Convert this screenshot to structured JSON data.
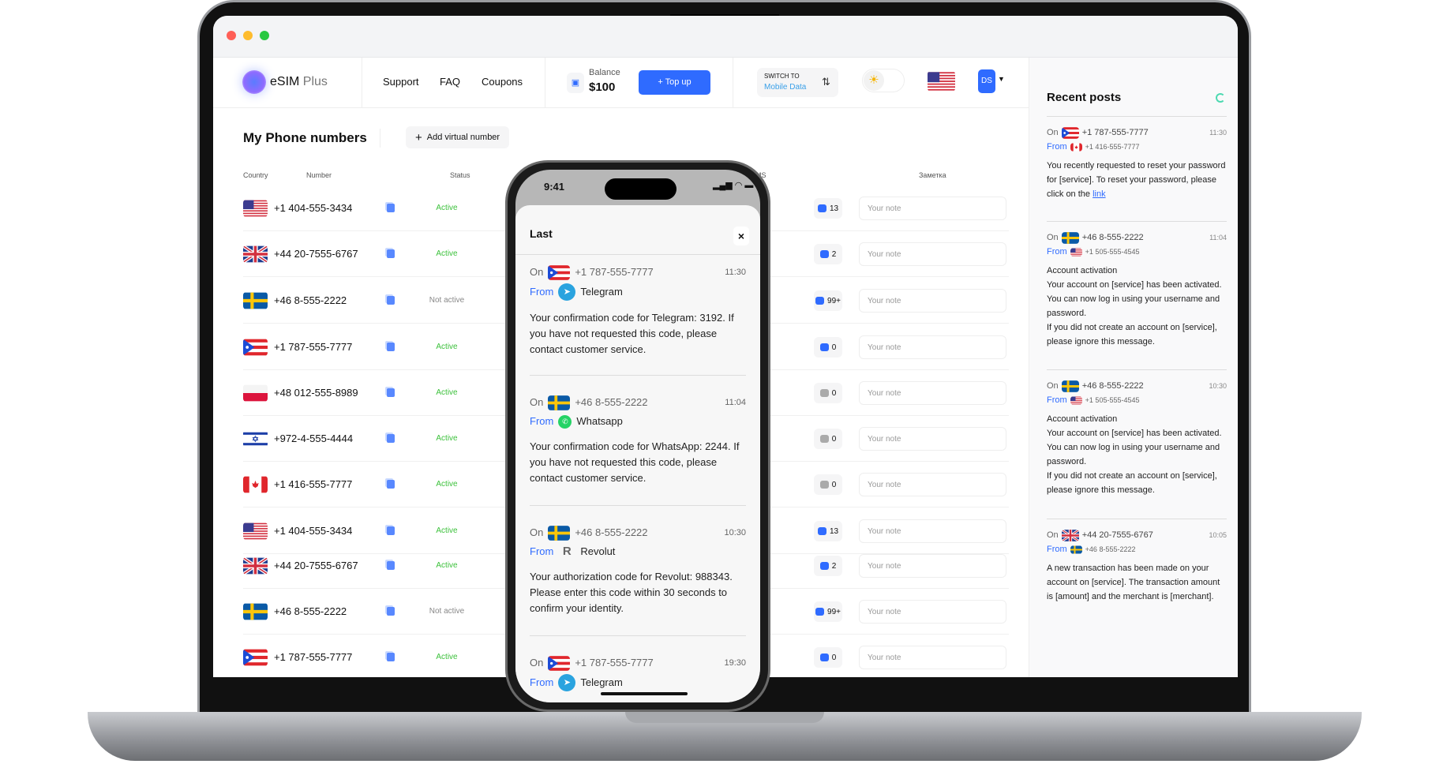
{
  "header": {
    "logo": "eSIM",
    "logo_plus": " Plus",
    "nav": [
      "Support",
      "FAQ",
      "Coupons"
    ],
    "balance_label": "Balance",
    "balance_value": "$100",
    "topup": "+ Top up",
    "switch_label": "SWITCH TO",
    "switch_value": "Mobile Data",
    "avatar": "DS",
    "theme_icon": "sun-icon",
    "flag": "us"
  },
  "main": {
    "title": "My Phone numbers",
    "add_button": "Add virtual number",
    "columns": {
      "country": "Country",
      "number": "Number",
      "status": "Status",
      "sms": "SMS",
      "note": "Заметка"
    },
    "rows": [
      {
        "flag": "us",
        "number": "+1 404-555-3434",
        "status": "Active",
        "sms": "13"
      },
      {
        "flag": "gb",
        "number": "+44 20-7555-6767",
        "status": "Active",
        "sms": "2"
      },
      {
        "flag": "se",
        "number": "+46 8-555-2222",
        "status": "Not active",
        "sms": "99+"
      },
      {
        "flag": "pr",
        "number": "+1 787-555-7777",
        "status": "Active",
        "sms": "0"
      },
      {
        "flag": "pl",
        "number": "+48 012-555-8989",
        "status": "Active",
        "sms": "0"
      },
      {
        "flag": "il",
        "number": "+972-4-555-4444",
        "status": "Active",
        "sms": "0"
      },
      {
        "flag": "ca",
        "number": "+1 416-555-7777",
        "status": "Active",
        "sms": "0"
      },
      {
        "flag": "us",
        "number": "+1 404-555-3434",
        "status": "Active",
        "sms": "13"
      },
      {
        "flag": "gb",
        "number": "+44 20-7555-6767",
        "status": "Active",
        "sms": "2"
      },
      {
        "flag": "se",
        "number": "+46 8-555-2222",
        "status": "Not active",
        "sms": "99+"
      },
      {
        "flag": "pr",
        "number": "+1 787-555-7777",
        "status": "Active",
        "sms": "0"
      }
    ],
    "note_placeholder": "Your note"
  },
  "recent": {
    "title": "Recent posts",
    "posts": [
      {
        "on_flag": "pr",
        "on": "+1 787-555-7777",
        "time": "11:30",
        "from_flag": "ca",
        "from": "+1 416-555-7777",
        "text": "You recently requested to reset your password for [service]. To reset your password, please click on the ",
        "link": "link"
      },
      {
        "on_flag": "se",
        "on": "+46 8-555-2222",
        "time": "11:04",
        "from_flag": "us",
        "from": "+1 505-555-4545",
        "text": "Account activation\nYour account on [service] has been activated. You can now log in using your username and password.\nIf you did not create an account on [service], please ignore this message."
      },
      {
        "on_flag": "se",
        "on": "+46 8-555-2222",
        "time": "10:30",
        "from_flag": "us",
        "from": "+1 505-555-4545",
        "text": "Account activation\nYour account on [service] has been activated. You can now log in using your username and password.\nIf you did not create an account on [service], please ignore this message."
      },
      {
        "on_flag": "gb",
        "on": "+44 20-7555-6767",
        "time": "10:05",
        "from_flag": "se",
        "from": "+46 8-555-2222",
        "text": "A new transaction has been made on your account on [service]. The transaction amount is [amount] and the merchant is [merchant]."
      }
    ]
  },
  "phone": {
    "time": "9:41",
    "title": "Last",
    "close": "×",
    "on_label": "On",
    "from_label": "From",
    "messages": [
      {
        "flag": "pr",
        "number": "+1 787-555-7777",
        "time": "11:30",
        "app": "Telegram",
        "app_icon": "telegram",
        "text": "Your confirmation code for Telegram: 3192. If you have not requested this code, please contact customer service."
      },
      {
        "flag": "se",
        "number": "+46 8-555-2222",
        "time": "11:04",
        "app": "Whatsapp",
        "app_icon": "whatsapp",
        "text": "Your confirmation code for WhatsApp: 2244. If you have not requested this code, please contact customer service."
      },
      {
        "flag": "se",
        "number": "+46 8-555-2222",
        "time": "10:30",
        "app": "Revolut",
        "app_icon": "revolut",
        "text": "Your authorization code for Revolut: 988343. Please enter this code within 30 seconds to confirm your identity."
      },
      {
        "flag": "pr",
        "number": "+1 787-555-7777",
        "time": "19:30",
        "app": "Telegram",
        "app_icon": "telegram",
        "text": ""
      }
    ]
  },
  "colors": {
    "accent": "#2f6bff",
    "active": "#3cc13b",
    "inactive": "#888888"
  }
}
